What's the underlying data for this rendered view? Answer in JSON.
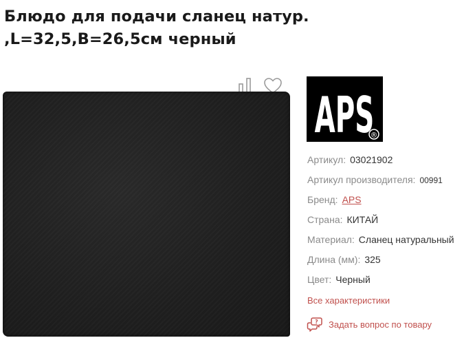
{
  "product": {
    "title": "Блюдо для подачи сланец натур. ,L=32,5,B=26,5см черный"
  },
  "actions": {
    "compare_icon": "compare-icon",
    "favorite_icon": "heart-icon"
  },
  "brand_logo": {
    "text": "APS",
    "mark": "®"
  },
  "specs": [
    {
      "label": "Артикул:",
      "value": "03021902"
    },
    {
      "label": "Артикул производителя:",
      "value": "00991"
    },
    {
      "label": "Бренд:",
      "value": "APS"
    },
    {
      "label": "Страна:",
      "value": "КИТАЙ"
    },
    {
      "label": "Материал:",
      "value": "Сланец натуральный"
    },
    {
      "label": "Длина (мм):",
      "value": "325"
    },
    {
      "label": "Цвет:",
      "value": "Черный"
    }
  ],
  "links": {
    "all_specs": "Все характеристики",
    "ask_question": "Задать вопрос по товару"
  },
  "colors": {
    "accent": "#c0504d",
    "label": "#8a8a8a",
    "slate": "#1f1f1f"
  }
}
